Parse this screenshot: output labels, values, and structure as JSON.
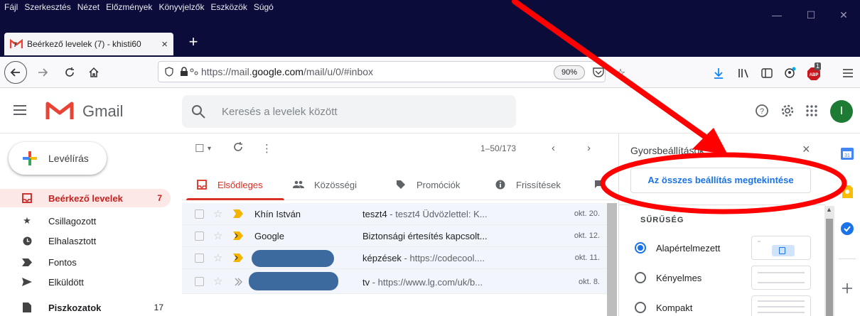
{
  "browser": {
    "menu": [
      "Fájl",
      "Szerkesztés",
      "Nézet",
      "Előzmények",
      "Könyvjelzők",
      "Eszközök",
      "Súgó"
    ],
    "tab_title": "Beérkező levelek (7) - khisti60",
    "tab_close": "×",
    "tab_badge": "7",
    "new_tab": "+",
    "url_prefix": "https://mail.",
    "url_domain": "google.com",
    "url_suffix": "/mail/u/0/#inbox",
    "zoom": "90%",
    "abp_badge": "1",
    "window_minimize": "—",
    "window_maximize": "☐",
    "window_close": "✕"
  },
  "gmail": {
    "logo_text": "Gmail",
    "search_placeholder": "Keresés a levelek között",
    "avatar_letter": "I",
    "compose_label": "Levélírás",
    "nav": [
      {
        "label": "Beérkező levelek",
        "count": "7",
        "icon": "inbox-icon",
        "active": true
      },
      {
        "label": "Csillagozott",
        "count": "",
        "icon": "star-icon"
      },
      {
        "label": "Elhalasztott",
        "count": "",
        "icon": "clock-icon"
      },
      {
        "label": "Fontos",
        "count": "",
        "icon": "important-icon"
      },
      {
        "label": "Elküldött",
        "count": "",
        "icon": "send-icon"
      },
      {
        "label": "Piszkozatok",
        "count": "17",
        "icon": "draft-icon",
        "bold": true
      }
    ],
    "pager": "1–50/173",
    "categories": [
      {
        "label": "Elsődleges",
        "icon": "inbox-icon",
        "active": true
      },
      {
        "label": "Közösségi",
        "icon": "people-icon"
      },
      {
        "label": "Promóciók",
        "icon": "tag-icon"
      },
      {
        "label": "Frissítések",
        "icon": "info-icon"
      }
    ],
    "mails": [
      {
        "sender": "Khín István",
        "subject": "teszt4",
        "snippet": " - teszt4 Üdvözlettel: K...",
        "date": "okt. 20."
      },
      {
        "sender": "Google",
        "subject": "Biztonsági értesítés kapcsolt...",
        "snippet": "",
        "date": "okt. 12."
      },
      {
        "sender": "",
        "subject": "képzések",
        "snippet": " - https://codecool....",
        "date": "okt. 11."
      },
      {
        "sender": "",
        "subject": "tv",
        "snippet": " - https://www.lg.com/uk/b...",
        "date": "okt. 8."
      }
    ]
  },
  "quick_settings": {
    "title": "Gyorsbeállítások",
    "close": "×",
    "all_settings_button": "Az összes beállítás megtekintése",
    "density_heading": "SŰRŰSÉG",
    "options": [
      {
        "label": "Alapértelmezett",
        "selected": true
      },
      {
        "label": "Kényelmes",
        "selected": false
      },
      {
        "label": "Kompakt",
        "selected": false
      }
    ]
  },
  "colors": {
    "titlebar": "#0c0c3a",
    "gmail_red": "#d93025",
    "link_blue": "#1a73e8",
    "annotation_red": "#ff0000"
  }
}
